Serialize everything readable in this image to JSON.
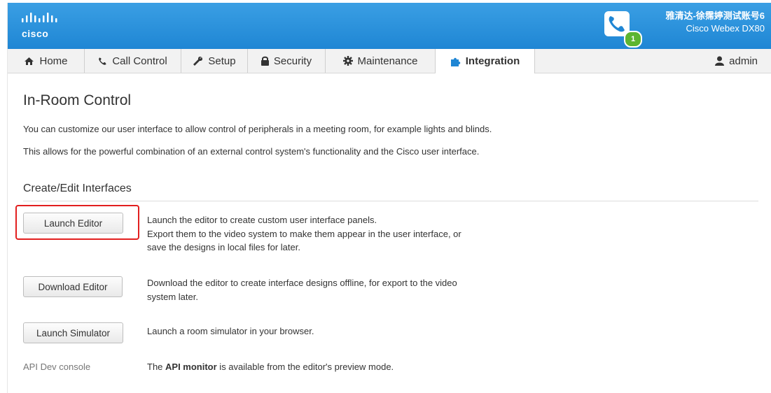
{
  "header": {
    "logo_text": "cisco",
    "device_line1": "雅清达-徐霈婷测试账号6",
    "device_line2": "Cisco Webex DX80",
    "call_badge": "1"
  },
  "nav": {
    "tabs": [
      {
        "label": "Home",
        "icon": "home-icon"
      },
      {
        "label": "Call Control",
        "icon": "phone-icon"
      },
      {
        "label": "Setup",
        "icon": "wrench-icon"
      },
      {
        "label": "Security",
        "icon": "lock-icon"
      },
      {
        "label": "Maintenance",
        "icon": "gear-icon"
      },
      {
        "label": "Integration",
        "icon": "puzzle-icon",
        "active": true
      }
    ],
    "user": {
      "label": "admin",
      "icon": "user-icon"
    }
  },
  "page": {
    "title": "In-Room Control",
    "intro1": "You can customize our user interface to allow control of peripherals in a meeting room, for example lights and blinds.",
    "intro2": "This allows for the powerful combination of an external control system's functionality and the Cisco user interface.",
    "section_title": "Create/Edit Interfaces"
  },
  "actions": {
    "launch_editor": {
      "label": "Launch Editor",
      "desc_line1": "Launch the editor to create custom user interface panels.",
      "desc_line2": "Export them to the video system to make them appear in the user interface, or",
      "desc_line3": "save the designs in local files for later."
    },
    "download_editor": {
      "label": "Download Editor",
      "desc_line1": "Download the editor to create interface designs offline, for export to the video",
      "desc_line2": "system later."
    },
    "launch_simulator": {
      "label": "Launch Simulator",
      "desc": "Launch a room simulator in your browser."
    },
    "api": {
      "label": "API Dev console",
      "desc_pre": "The ",
      "desc_bold": "API monitor",
      "desc_post": " is available from the editor's preview mode."
    }
  },
  "colors": {
    "header_blue": "#1f86d4",
    "highlight_red": "#e21f1f",
    "badge_green": "#5cb531",
    "integration_icon": "#1f86d4"
  }
}
